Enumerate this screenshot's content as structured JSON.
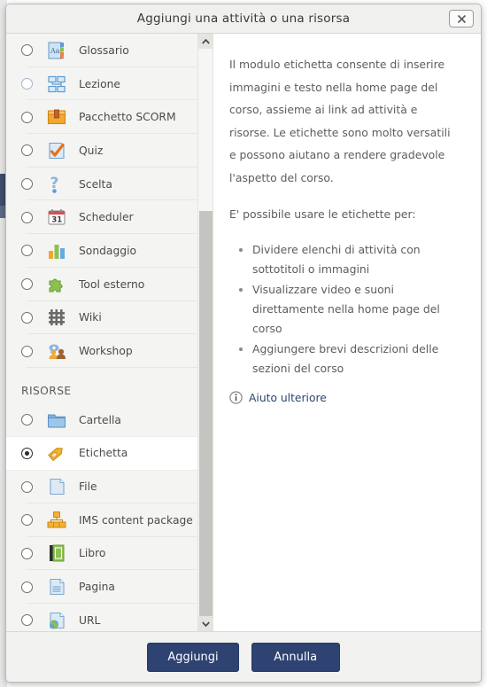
{
  "dialog": {
    "title": "Aggiungi una attività o una risorsa",
    "close_icon": "close-icon"
  },
  "list": {
    "activities": [
      {
        "label": "Glossario",
        "icon": "glossary-icon",
        "selected": false
      },
      {
        "label": "Lezione",
        "icon": "lesson-icon",
        "selected": false
      },
      {
        "label": "Pacchetto SCORM",
        "icon": "scorm-icon",
        "selected": false
      },
      {
        "label": "Quiz",
        "icon": "quiz-icon",
        "selected": false
      },
      {
        "label": "Scelta",
        "icon": "choice-icon",
        "selected": false
      },
      {
        "label": "Scheduler",
        "icon": "calendar-icon",
        "selected": false
      },
      {
        "label": "Sondaggio",
        "icon": "survey-icon",
        "selected": false
      },
      {
        "label": "Tool esterno",
        "icon": "puzzle-icon",
        "selected": false
      },
      {
        "label": "Wiki",
        "icon": "wiki-icon",
        "selected": false
      },
      {
        "label": "Workshop",
        "icon": "workshop-icon",
        "selected": false
      }
    ],
    "section_resources_label": "RISORSE",
    "resources": [
      {
        "label": "Cartella",
        "icon": "folder-icon",
        "selected": false
      },
      {
        "label": "Etichetta",
        "icon": "label-icon",
        "selected": true
      },
      {
        "label": "File",
        "icon": "file-icon",
        "selected": false
      },
      {
        "label": "IMS content package",
        "icon": "ims-icon",
        "selected": false
      },
      {
        "label": "Libro",
        "icon": "book-icon",
        "selected": false
      },
      {
        "label": "Pagina",
        "icon": "page-icon",
        "selected": false
      },
      {
        "label": "URL",
        "icon": "url-icon",
        "selected": false
      }
    ],
    "scroll_up_icon": "chevron-up-icon",
    "scroll_down_icon": "chevron-down-icon"
  },
  "description": {
    "paragraph1": "Il modulo etichetta consente di inserire immagini e testo nella home page del corso, assieme ai link ad attività e risorse. Le etichette sono molto versatili e possono aiutano a rendere gradevole l'aspetto del corso.",
    "paragraph2": "E' possibile usare le etichette per:",
    "bullets": [
      "Dividere elenchi di attività con sottotitoli o immagini",
      "Visualizzare video e suoni direttamente nella home page del corso",
      "Aggiungere brevi descrizioni delle sezioni del corso"
    ],
    "help_link_label": "Aiuto ulteriore",
    "help_icon": "info-circle-icon"
  },
  "footer": {
    "submit_label": "Aggiungi",
    "cancel_label": "Annulla"
  },
  "colors": {
    "button_bg": "#2e4372",
    "title_bar": "#f0f0ee",
    "list_bg": "#f4f4f2",
    "selected_row_bg": "#ffffff",
    "link": "#2f4470",
    "text": "#5d5d5d"
  }
}
